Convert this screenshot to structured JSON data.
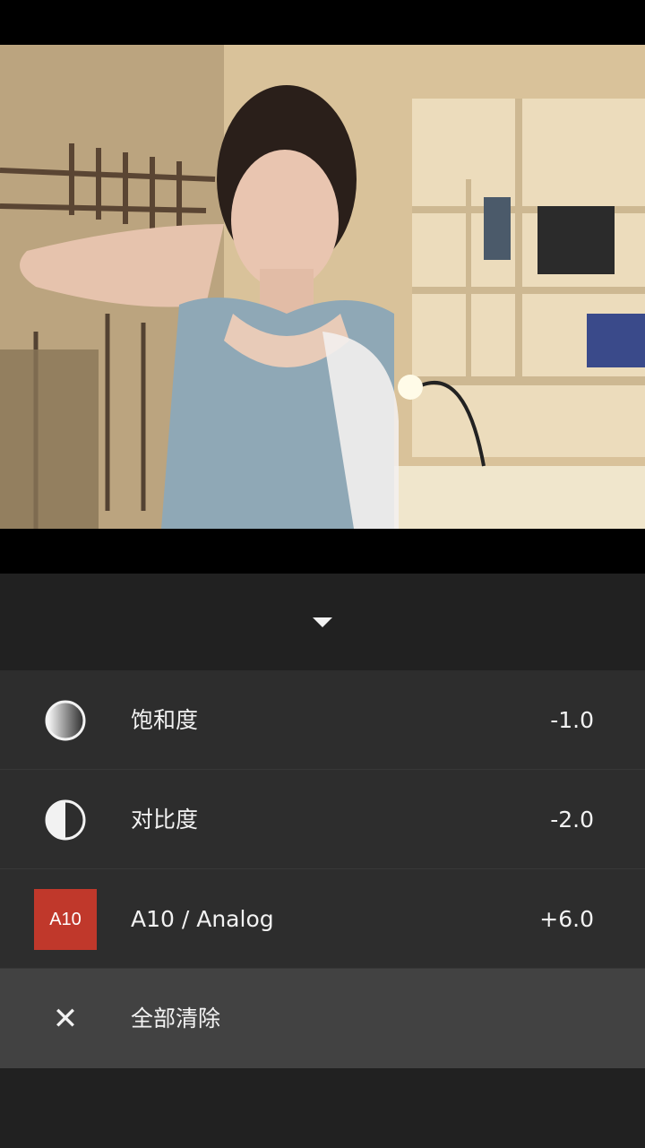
{
  "photo": {
    "icon": "portrait-photo"
  },
  "collapse": {
    "icon": "caret-down-icon"
  },
  "adjustments": [
    {
      "icon": "saturation-icon",
      "label": "饱和度",
      "value": "-1.0"
    },
    {
      "icon": "contrast-icon",
      "label": "对比度",
      "value": "-2.0"
    },
    {
      "icon": "preset-badge",
      "badge": "A10",
      "label": "A10 / Analog",
      "value": "+6.0"
    }
  ],
  "clear_all": {
    "icon": "close-icon",
    "label": "全部清除"
  },
  "colors": {
    "panel": "#212121",
    "row": "#2d2d2d",
    "clear_row": "#424242",
    "preset_accent": "#c0382b"
  }
}
